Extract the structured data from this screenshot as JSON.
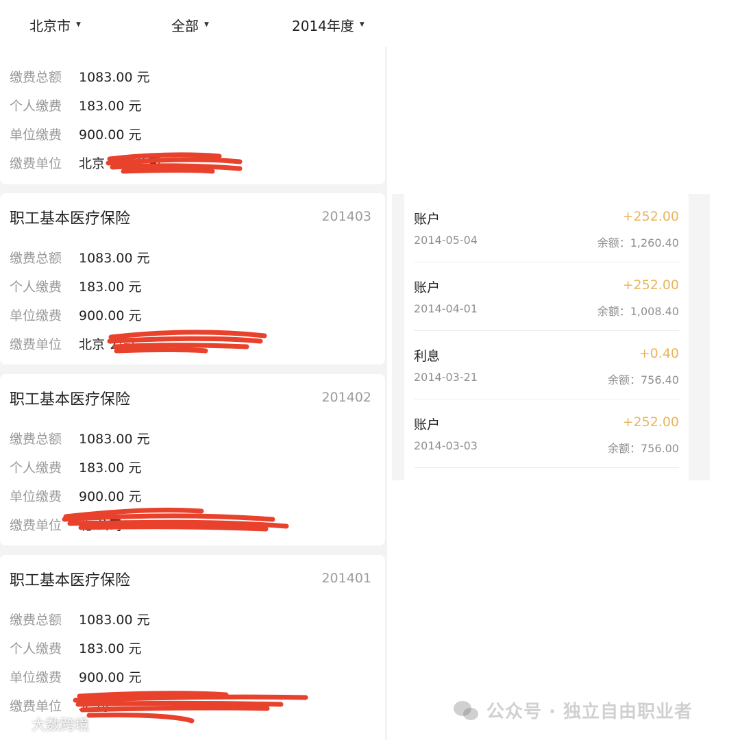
{
  "filters": {
    "city": "北京市",
    "type": "全部",
    "year": "2014年度"
  },
  "labels": {
    "total": "缴费总额",
    "personal": "个人缴费",
    "company": "单位缴费",
    "employer": "缴费单位"
  },
  "cards": [
    {
      "title": "",
      "period": "",
      "total": "1083.00 元",
      "personal": "183.00 元",
      "company": "900.00 元",
      "employer": "北京 有限公司"
    },
    {
      "title": "职工基本医疗保险",
      "period": "201403",
      "total": "1083.00 元",
      "personal": "183.00 元",
      "company": "900.00 元",
      "employer": "北京 公司"
    },
    {
      "title": "职工基本医疗保险",
      "period": "201402",
      "total": "1083.00 元",
      "personal": "183.00 元",
      "company": "900.00 元",
      "employer": "北 公司"
    },
    {
      "title": "职工基本医疗保险",
      "period": "201401",
      "total": "1083.00 元",
      "personal": "183.00 元",
      "company": "900.00 元",
      "employer": "北 司"
    }
  ],
  "transactions": [
    {
      "type": "账户",
      "amount": "+252.00",
      "date": "2014-05-04",
      "balance": "余额：1,260.40"
    },
    {
      "type": "账户",
      "amount": "+252.00",
      "date": "2014-04-01",
      "balance": "余额：1,008.40"
    },
    {
      "type": "利息",
      "amount": "+0.40",
      "date": "2014-03-21",
      "balance": "余额：756.40"
    },
    {
      "type": "账户",
      "amount": "+252.00",
      "date": "2014-03-03",
      "balance": "余额：756.00"
    }
  ],
  "watermarks": {
    "bottom_left": "大数跨境",
    "bottom_right": "公众号 · 独立自由职业者"
  },
  "colors": {
    "amount": "#e9b45a",
    "redaction": "#e8412c",
    "label": "#9a9a9a"
  },
  "icons": {
    "dropdown": "caret-down-icon",
    "watermark_logo": "weibo-logo-icon",
    "wechat": "wechat-logo-icon"
  }
}
